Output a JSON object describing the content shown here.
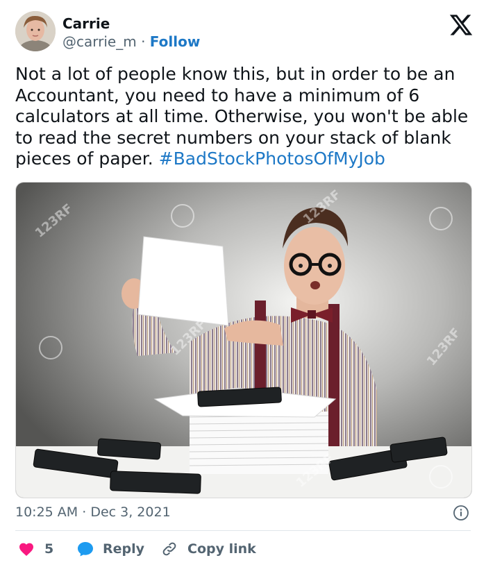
{
  "user": {
    "name": "Carrie",
    "handle": "@carrie_m",
    "separator": "·",
    "follow_label": "Follow"
  },
  "tweet": {
    "text": "Not a lot of people know this, but in order to be an Accountant, you need to have a minimum of 6 calculators at all time. Otherwise, you won't be able to read the secret numbers on your stack of blank pieces of paper.",
    "hashtag": "#BadStockPhotosOfMyJob"
  },
  "media": {
    "watermark_text": "123RF"
  },
  "meta": {
    "time": "10:25 AM",
    "separator": "·",
    "date": "Dec 3, 2021"
  },
  "actions": {
    "like_count": "5",
    "reply_label": "Reply",
    "copy_link_label": "Copy link"
  },
  "colors": {
    "link": "#1d78c6",
    "like": "#f91880",
    "reply": "#1d9bf0",
    "secondary_text": "#536471"
  }
}
